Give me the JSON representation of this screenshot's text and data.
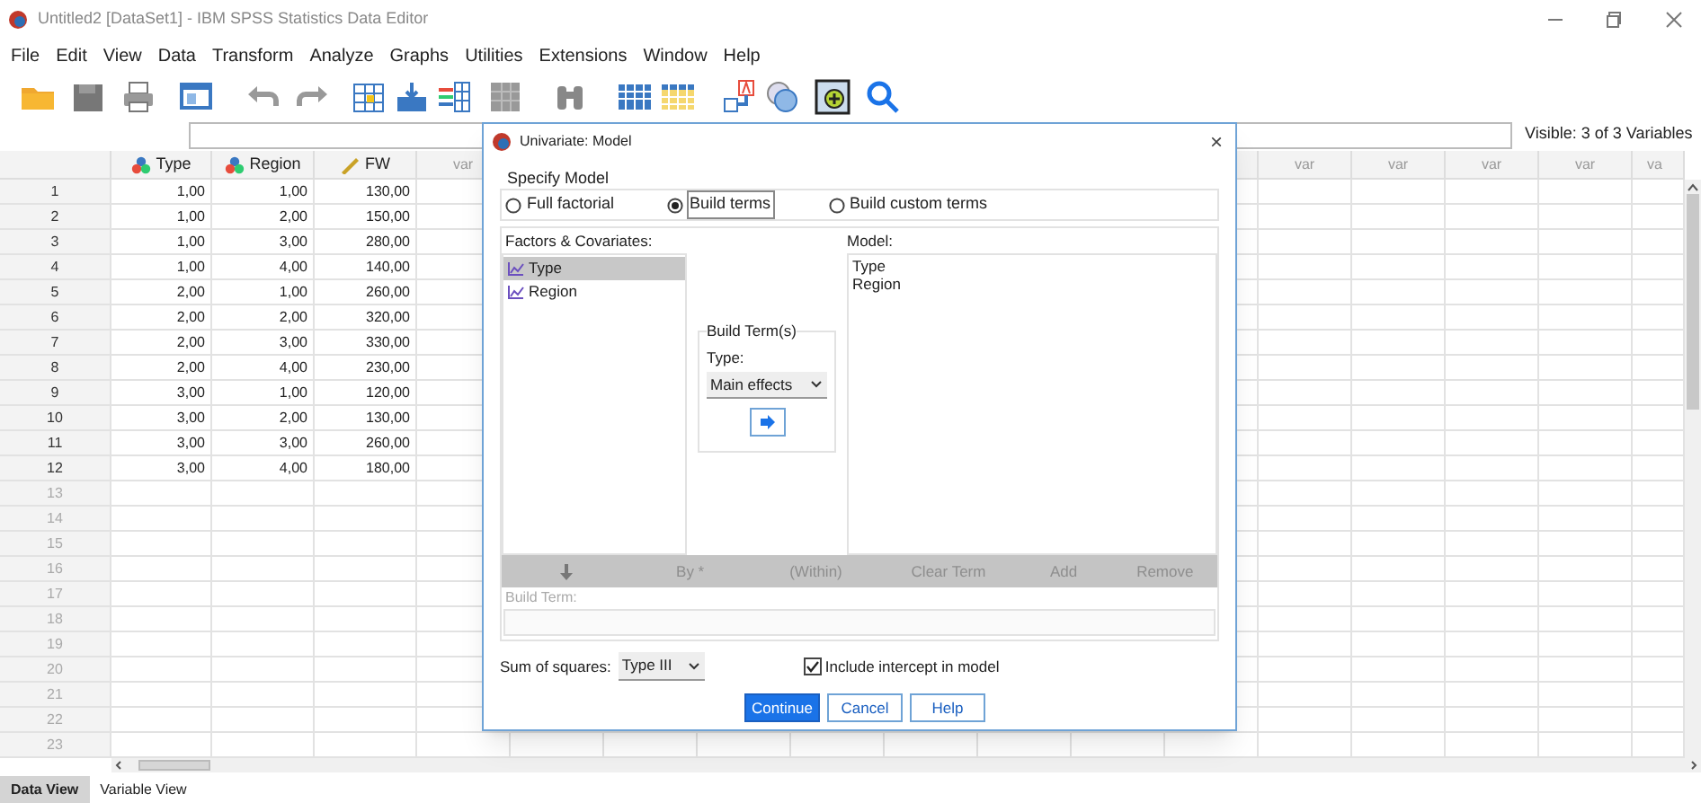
{
  "window": {
    "title": "Untitled2 [DataSet1] - IBM SPSS Statistics Data Editor"
  },
  "menu": [
    "File",
    "Edit",
    "View",
    "Data",
    "Transform",
    "Analyze",
    "Graphs",
    "Utilities",
    "Extensions",
    "Window",
    "Help"
  ],
  "status": {
    "visible": "Visible: 3 of 3 Variables"
  },
  "grid": {
    "columns": [
      {
        "label": "Type",
        "kind": "nominal"
      },
      {
        "label": "Region",
        "kind": "nominal"
      },
      {
        "label": "FW",
        "kind": "scale"
      }
    ],
    "var_headers_left": [
      "var"
    ],
    "var_headers_right": [
      "var",
      "var",
      "var",
      "var",
      "va"
    ],
    "rows": [
      {
        "number": "1",
        "cells": [
          "1,00",
          "1,00",
          "130,00"
        ]
      },
      {
        "number": "2",
        "cells": [
          "1,00",
          "2,00",
          "150,00"
        ]
      },
      {
        "number": "3",
        "cells": [
          "1,00",
          "3,00",
          "280,00"
        ]
      },
      {
        "number": "4",
        "cells": [
          "1,00",
          "4,00",
          "140,00"
        ]
      },
      {
        "number": "5",
        "cells": [
          "2,00",
          "1,00",
          "260,00"
        ]
      },
      {
        "number": "6",
        "cells": [
          "2,00",
          "2,00",
          "320,00"
        ]
      },
      {
        "number": "7",
        "cells": [
          "2,00",
          "3,00",
          "330,00"
        ]
      },
      {
        "number": "8",
        "cells": [
          "2,00",
          "4,00",
          "230,00"
        ]
      },
      {
        "number": "9",
        "cells": [
          "3,00",
          "1,00",
          "120,00"
        ]
      },
      {
        "number": "10",
        "cells": [
          "3,00",
          "2,00",
          "130,00"
        ]
      },
      {
        "number": "11",
        "cells": [
          "3,00",
          "3,00",
          "260,00"
        ]
      },
      {
        "number": "12",
        "cells": [
          "3,00",
          "4,00",
          "180,00"
        ]
      },
      {
        "number": "13"
      },
      {
        "number": "14"
      },
      {
        "number": "15"
      },
      {
        "number": "16"
      },
      {
        "number": "17"
      },
      {
        "number": "18"
      },
      {
        "number": "19"
      },
      {
        "number": "20"
      },
      {
        "number": "21"
      },
      {
        "number": "22"
      },
      {
        "number": "23"
      }
    ]
  },
  "view_tabs": [
    {
      "label": "Data View",
      "selected": true
    },
    {
      "label": "Variable View",
      "selected": false
    }
  ],
  "dialog": {
    "title": "Univariate: Model",
    "close": "×",
    "specify_model": {
      "label": "Specify Model",
      "options": [
        {
          "label": "Full factorial",
          "selected": false
        },
        {
          "label": "Build terms",
          "selected": true
        },
        {
          "label": "Build custom terms",
          "selected": false
        }
      ]
    },
    "factors": {
      "label": "Factors & Covariates:",
      "items": [
        {
          "label": "Type",
          "selected": true
        },
        {
          "label": "Region",
          "selected": false
        }
      ]
    },
    "build_terms": {
      "label": "Build Term(s)",
      "type_label": "Type:",
      "type_value": "Main effects"
    },
    "model": {
      "label": "Model:",
      "items": [
        "Type",
        "Region"
      ]
    },
    "term_buttons": [
      {
        "kind": "arrow",
        "disabled": true
      },
      {
        "label": "By *",
        "kind": "text",
        "disabled": true
      },
      {
        "label": "(Within)",
        "kind": "text",
        "disabled": true
      },
      {
        "label": "Clear Term",
        "kind": "text",
        "disabled": true
      },
      {
        "label": "Add",
        "kind": "text",
        "disabled": true
      },
      {
        "label": "Remove",
        "kind": "text",
        "disabled": true
      }
    ],
    "build_term": {
      "label": "Build Term:",
      "disabled": true
    },
    "sum_of_squares": {
      "label": "Sum of squares:",
      "value": "Type III"
    },
    "include_intercept": {
      "label": "Include intercept in model",
      "checked": true
    },
    "buttons": [
      {
        "label": "Continue",
        "primary": true
      },
      {
        "label": "Cancel",
        "primary": false
      },
      {
        "label": "Help",
        "primary": false
      }
    ]
  }
}
